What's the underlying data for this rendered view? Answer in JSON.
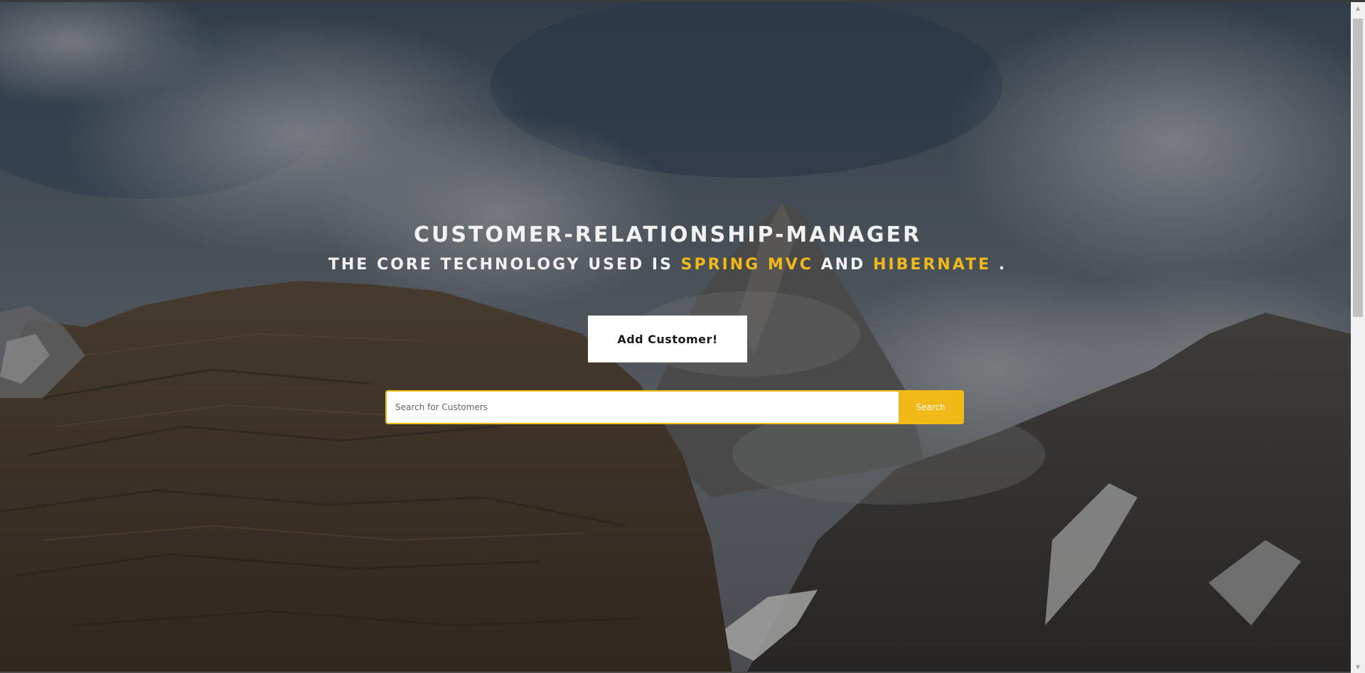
{
  "hero": {
    "title": "CUSTOMER-RELATIONSHIP-MANAGER",
    "subtitle_prefix": "THE CORE TECHNOLOGY USED IS",
    "subtitle_tech1": "SPRING MVC",
    "subtitle_and": "AND",
    "subtitle_tech2": "HIBERNATE",
    "subtitle_suffix": "."
  },
  "actions": {
    "add_customer_label": "Add Customer!"
  },
  "search": {
    "placeholder": "Search for Customers",
    "value": "",
    "button_label": "Search"
  },
  "colors": {
    "accent": "#f1b916",
    "title_text": "#f2f2f2",
    "button_bg": "#ffffff"
  },
  "icons": {
    "scroll_up": "scroll-up-arrow",
    "scroll_down": "scroll-down-arrow"
  }
}
